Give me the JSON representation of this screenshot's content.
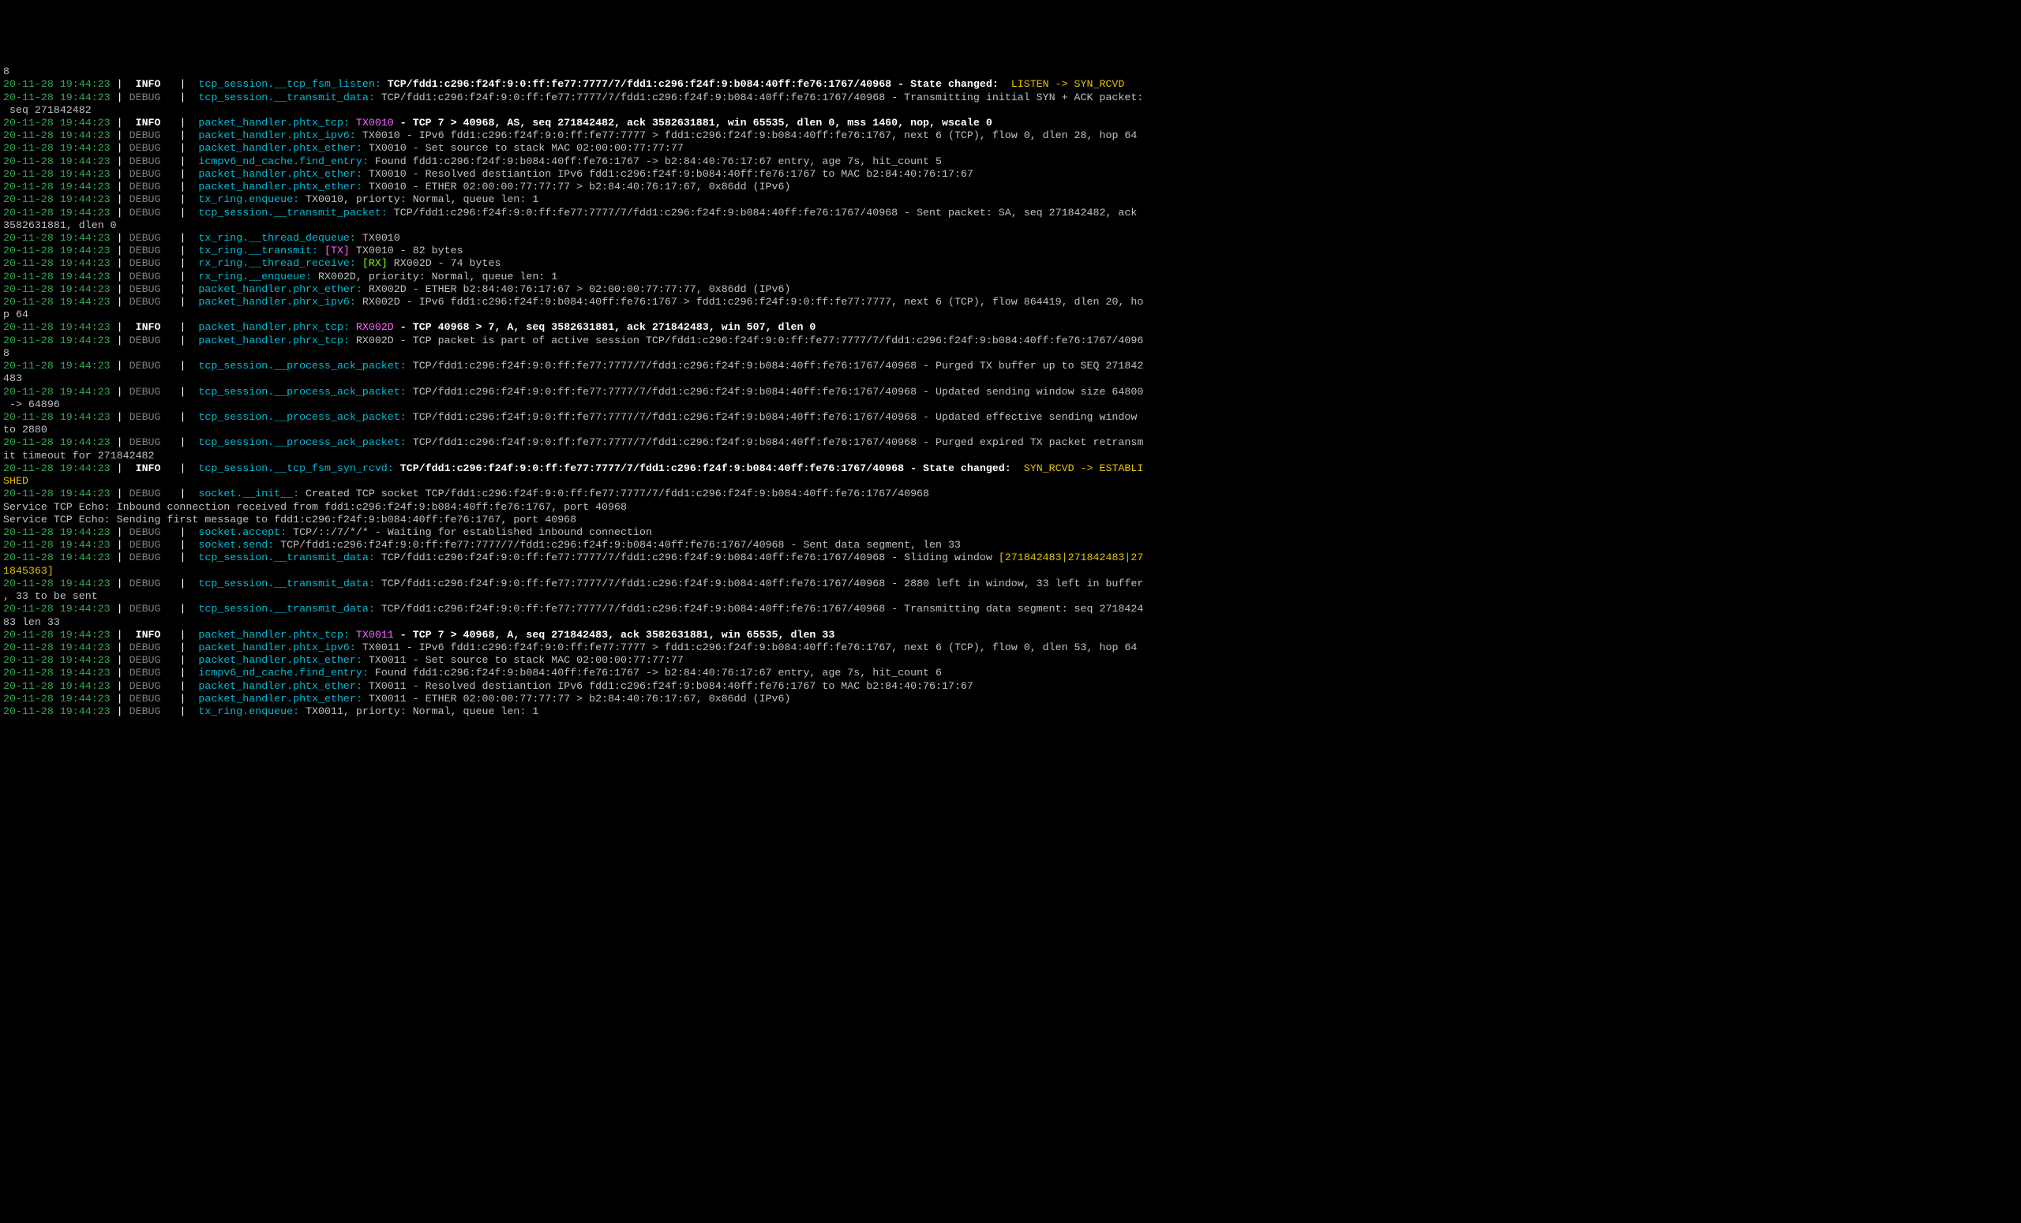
{
  "colors": {
    "timestamp": "#34a853",
    "info": "#ffffff",
    "debug": "#808080",
    "source": "#00bcd4",
    "yellow": "#e6c200",
    "magenta": "#ff66ff",
    "lime": "#7fff00"
  },
  "lines": [
    {
      "type": "wrap",
      "text": "8"
    },
    {
      "ts": "20-11-28 19:44:23",
      "level": "INFO",
      "src": "tcp_session.__tcp_fsm_listen:",
      "segs": [
        {
          "cls": "white",
          "text": " TCP/fdd1:c296:f24f:9:0:ff:fe77:7777/7/fdd1:c296:f24f:9:b084:40ff:fe76:1767/40968 - State changed: "
        },
        {
          "cls": "yellow",
          "text": " LISTEN -> SYN_RCVD"
        }
      ]
    },
    {
      "ts": "20-11-28 19:44:23",
      "level": "DEBUG",
      "src": "tcp_session.__transmit_data:",
      "segs": [
        {
          "cls": "msg",
          "text": " TCP/fdd1:c296:f24f:9:0:ff:fe77:7777/7/fdd1:c296:f24f:9:b084:40ff:fe76:1767/40968 - Transmitting initial SYN + ACK packet:"
        }
      ]
    },
    {
      "type": "wrap",
      "text": " seq 271842482"
    },
    {
      "ts": "20-11-28 19:44:23",
      "level": "INFO",
      "src": "packet_handler.phtx_tcp:",
      "segs": [
        {
          "cls": "magenta",
          "text": " TX0010"
        },
        {
          "cls": "white",
          "text": " - TCP 7 > 40968, AS, seq 271842482, ack 3582631881, win 65535, dlen 0, mss 1460, nop, wscale 0"
        }
      ]
    },
    {
      "ts": "20-11-28 19:44:23",
      "level": "DEBUG",
      "src": "packet_handler.phtx_ipv6:",
      "segs": [
        {
          "cls": "msg",
          "text": " TX0010 - IPv6 fdd1:c296:f24f:9:0:ff:fe77:7777 > fdd1:c296:f24f:9:b084:40ff:fe76:1767, next 6 (TCP), flow 0, dlen 28, hop 64"
        }
      ]
    },
    {
      "ts": "20-11-28 19:44:23",
      "level": "DEBUG",
      "src": "packet_handler.phtx_ether:",
      "segs": [
        {
          "cls": "msg",
          "text": " TX0010 - Set source to stack MAC 02:00:00:77:77:77"
        }
      ]
    },
    {
      "ts": "20-11-28 19:44:23",
      "level": "DEBUG",
      "src": "icmpv6_nd_cache.find_entry:",
      "segs": [
        {
          "cls": "msg",
          "text": " Found fdd1:c296:f24f:9:b084:40ff:fe76:1767 -> b2:84:40:76:17:67 entry, age 7s, hit_count 5"
        }
      ]
    },
    {
      "ts": "20-11-28 19:44:23",
      "level": "DEBUG",
      "src": "packet_handler.phtx_ether:",
      "segs": [
        {
          "cls": "msg",
          "text": " TX0010 - Resolved destiantion IPv6 fdd1:c296:f24f:9:b084:40ff:fe76:1767 to MAC b2:84:40:76:17:67"
        }
      ]
    },
    {
      "ts": "20-11-28 19:44:23",
      "level": "DEBUG",
      "src": "packet_handler.phtx_ether:",
      "segs": [
        {
          "cls": "msg",
          "text": " TX0010 - ETHER 02:00:00:77:77:77 > b2:84:40:76:17:67, 0x86dd (IPv6)"
        }
      ]
    },
    {
      "ts": "20-11-28 19:44:23",
      "level": "DEBUG",
      "src": "tx_ring.enqueue:",
      "segs": [
        {
          "cls": "msg",
          "text": " TX0010, priorty: Normal, queue len: 1"
        }
      ]
    },
    {
      "ts": "20-11-28 19:44:23",
      "level": "DEBUG",
      "src": "tcp_session.__transmit_packet:",
      "segs": [
        {
          "cls": "msg",
          "text": " TCP/fdd1:c296:f24f:9:0:ff:fe77:7777/7/fdd1:c296:f24f:9:b084:40ff:fe76:1767/40968 - Sent packet: SA, seq 271842482, ack "
        }
      ]
    },
    {
      "type": "wrap",
      "text": "3582631881, dlen 0"
    },
    {
      "ts": "20-11-28 19:44:23",
      "level": "DEBUG",
      "src": "tx_ring.__thread_dequeue:",
      "segs": [
        {
          "cls": "msg",
          "text": " TX0010"
        }
      ]
    },
    {
      "ts": "20-11-28 19:44:23",
      "level": "DEBUG",
      "src": "tx_ring.__transmit:",
      "segs": [
        {
          "cls": "magenta",
          "text": " [TX]"
        },
        {
          "cls": "msg",
          "text": " TX0010 - 82 bytes"
        }
      ]
    },
    {
      "ts": "20-11-28 19:44:23",
      "level": "DEBUG",
      "src": "rx_ring.__thread_receive:",
      "segs": [
        {
          "cls": "lime",
          "text": " [RX]"
        },
        {
          "cls": "msg",
          "text": " RX002D - 74 bytes"
        }
      ]
    },
    {
      "ts": "20-11-28 19:44:23",
      "level": "DEBUG",
      "src": "rx_ring.__enqueue:",
      "segs": [
        {
          "cls": "msg",
          "text": " RX002D, priority: Normal, queue len: 1"
        }
      ]
    },
    {
      "ts": "20-11-28 19:44:23",
      "level": "DEBUG",
      "src": "packet_handler.phrx_ether:",
      "segs": [
        {
          "cls": "msg",
          "text": " RX002D - ETHER b2:84:40:76:17:67 > 02:00:00:77:77:77, 0x86dd (IPv6)"
        }
      ]
    },
    {
      "ts": "20-11-28 19:44:23",
      "level": "DEBUG",
      "src": "packet_handler.phrx_ipv6:",
      "segs": [
        {
          "cls": "msg",
          "text": " RX002D - IPv6 fdd1:c296:f24f:9:b084:40ff:fe76:1767 > fdd1:c296:f24f:9:0:ff:fe77:7777, next 6 (TCP), flow 864419, dlen 20, ho"
        }
      ]
    },
    {
      "type": "wrap",
      "text": "p 64"
    },
    {
      "ts": "20-11-28 19:44:23",
      "level": "INFO",
      "src": "packet_handler.phrx_tcp:",
      "segs": [
        {
          "cls": "magenta",
          "text": " RX002D"
        },
        {
          "cls": "white",
          "text": " - TCP 40968 > 7, A, seq 3582631881, ack 271842483, win 507, dlen 0"
        }
      ]
    },
    {
      "ts": "20-11-28 19:44:23",
      "level": "DEBUG",
      "src": "packet_handler.phrx_tcp:",
      "segs": [
        {
          "cls": "msg",
          "text": " RX002D - TCP packet is part of active session TCP/fdd1:c296:f24f:9:0:ff:fe77:7777/7/fdd1:c296:f24f:9:b084:40ff:fe76:1767/4096"
        }
      ]
    },
    {
      "type": "wrap",
      "text": "8"
    },
    {
      "ts": "20-11-28 19:44:23",
      "level": "DEBUG",
      "src": "tcp_session.__process_ack_packet:",
      "segs": [
        {
          "cls": "msg",
          "text": " TCP/fdd1:c296:f24f:9:0:ff:fe77:7777/7/fdd1:c296:f24f:9:b084:40ff:fe76:1767/40968 - Purged TX buffer up to SEQ 271842"
        }
      ]
    },
    {
      "type": "wrap",
      "text": "483"
    },
    {
      "ts": "20-11-28 19:44:23",
      "level": "DEBUG",
      "src": "tcp_session.__process_ack_packet:",
      "segs": [
        {
          "cls": "msg",
          "text": " TCP/fdd1:c296:f24f:9:0:ff:fe77:7777/7/fdd1:c296:f24f:9:b084:40ff:fe76:1767/40968 - Updated sending window size 64800"
        }
      ]
    },
    {
      "type": "wrap",
      "text": " -> 64896"
    },
    {
      "ts": "20-11-28 19:44:23",
      "level": "DEBUG",
      "src": "tcp_session.__process_ack_packet:",
      "segs": [
        {
          "cls": "msg",
          "text": " TCP/fdd1:c296:f24f:9:0:ff:fe77:7777/7/fdd1:c296:f24f:9:b084:40ff:fe76:1767/40968 - Updated effective sending window "
        }
      ]
    },
    {
      "type": "wrap",
      "text": "to 2880"
    },
    {
      "ts": "20-11-28 19:44:23",
      "level": "DEBUG",
      "src": "tcp_session.__process_ack_packet:",
      "segs": [
        {
          "cls": "msg",
          "text": " TCP/fdd1:c296:f24f:9:0:ff:fe77:7777/7/fdd1:c296:f24f:9:b084:40ff:fe76:1767/40968 - Purged expired TX packet retransm"
        }
      ]
    },
    {
      "type": "wrap",
      "text": "it timeout for 271842482"
    },
    {
      "ts": "20-11-28 19:44:23",
      "level": "INFO",
      "src": "tcp_session.__tcp_fsm_syn_rcvd:",
      "segs": [
        {
          "cls": "white",
          "text": " TCP/fdd1:c296:f24f:9:0:ff:fe77:7777/7/fdd1:c296:f24f:9:b084:40ff:fe76:1767/40968 - State changed: "
        },
        {
          "cls": "yellow",
          "text": " SYN_RCVD -> ESTABLI"
        }
      ]
    },
    {
      "type": "wrap",
      "cls": "yellow",
      "text": "SHED"
    },
    {
      "ts": "20-11-28 19:44:23",
      "level": "DEBUG",
      "src": "socket.__init__:",
      "segs": [
        {
          "cls": "msg",
          "text": " Created TCP socket TCP/fdd1:c296:f24f:9:0:ff:fe77:7777/7/fdd1:c296:f24f:9:b084:40ff:fe76:1767/40968"
        }
      ]
    },
    {
      "type": "raw",
      "text": "Service TCP Echo: Inbound connection received from fdd1:c296:f24f:9:b084:40ff:fe76:1767, port 40968"
    },
    {
      "type": "raw",
      "text": "Service TCP Echo: Sending first message to fdd1:c296:f24f:9:b084:40ff:fe76:1767, port 40968"
    },
    {
      "ts": "20-11-28 19:44:23",
      "level": "DEBUG",
      "src": "socket.accept:",
      "segs": [
        {
          "cls": "msg",
          "text": " TCP/::/7/*/* - Waiting for established inbound connection"
        }
      ]
    },
    {
      "ts": "20-11-28 19:44:23",
      "level": "DEBUG",
      "src": "socket.send:",
      "segs": [
        {
          "cls": "msg",
          "text": " TCP/fdd1:c296:f24f:9:0:ff:fe77:7777/7/fdd1:c296:f24f:9:b084:40ff:fe76:1767/40968 - Sent data segment, len 33"
        }
      ]
    },
    {
      "ts": "20-11-28 19:44:23",
      "level": "DEBUG",
      "src": "tcp_session.__transmit_data:",
      "segs": [
        {
          "cls": "msg",
          "text": " TCP/fdd1:c296:f24f:9:0:ff:fe77:7777/7/fdd1:c296:f24f:9:b084:40ff:fe76:1767/40968 - Sliding window "
        },
        {
          "cls": "yellow",
          "text": "[271842483|271842483|27"
        }
      ]
    },
    {
      "type": "wrap",
      "cls": "yellow",
      "text": "1845363]"
    },
    {
      "ts": "20-11-28 19:44:23",
      "level": "DEBUG",
      "src": "tcp_session.__transmit_data:",
      "segs": [
        {
          "cls": "msg",
          "text": " TCP/fdd1:c296:f24f:9:0:ff:fe77:7777/7/fdd1:c296:f24f:9:b084:40ff:fe76:1767/40968 - 2880 left in window, 33 left in buffer"
        }
      ]
    },
    {
      "type": "wrap",
      "text": ", 33 to be sent"
    },
    {
      "ts": "20-11-28 19:44:23",
      "level": "DEBUG",
      "src": "tcp_session.__transmit_data:",
      "segs": [
        {
          "cls": "msg",
          "text": " TCP/fdd1:c296:f24f:9:0:ff:fe77:7777/7/fdd1:c296:f24f:9:b084:40ff:fe76:1767/40968 - Transmitting data segment: seq 2718424"
        }
      ]
    },
    {
      "type": "wrap",
      "text": "83 len 33"
    },
    {
      "ts": "20-11-28 19:44:23",
      "level": "INFO",
      "src": "packet_handler.phtx_tcp:",
      "segs": [
        {
          "cls": "magenta",
          "text": " TX0011"
        },
        {
          "cls": "white",
          "text": " - TCP 7 > 40968, A, seq 271842483, ack 3582631881, win 65535, dlen 33"
        }
      ]
    },
    {
      "ts": "20-11-28 19:44:23",
      "level": "DEBUG",
      "src": "packet_handler.phtx_ipv6:",
      "segs": [
        {
          "cls": "msg",
          "text": " TX0011 - IPv6 fdd1:c296:f24f:9:0:ff:fe77:7777 > fdd1:c296:f24f:9:b084:40ff:fe76:1767, next 6 (TCP), flow 0, dlen 53, hop 64"
        }
      ]
    },
    {
      "ts": "20-11-28 19:44:23",
      "level": "DEBUG",
      "src": "packet_handler.phtx_ether:",
      "segs": [
        {
          "cls": "msg",
          "text": " TX0011 - Set source to stack MAC 02:00:00:77:77:77"
        }
      ]
    },
    {
      "ts": "20-11-28 19:44:23",
      "level": "DEBUG",
      "src": "icmpv6_nd_cache.find_entry:",
      "segs": [
        {
          "cls": "msg",
          "text": " Found fdd1:c296:f24f:9:b084:40ff:fe76:1767 -> b2:84:40:76:17:67 entry, age 7s, hit_count 6"
        }
      ]
    },
    {
      "ts": "20-11-28 19:44:23",
      "level": "DEBUG",
      "src": "packet_handler.phtx_ether:",
      "segs": [
        {
          "cls": "msg",
          "text": " TX0011 - Resolved destiantion IPv6 fdd1:c296:f24f:9:b084:40ff:fe76:1767 to MAC b2:84:40:76:17:67"
        }
      ]
    },
    {
      "ts": "20-11-28 19:44:23",
      "level": "DEBUG",
      "src": "packet_handler.phtx_ether:",
      "segs": [
        {
          "cls": "msg",
          "text": " TX0011 - ETHER 02:00:00:77:77:77 > b2:84:40:76:17:67, 0x86dd (IPv6)"
        }
      ]
    },
    {
      "ts": "20-11-28 19:44:23",
      "level": "DEBUG",
      "src": "tx_ring.enqueue:",
      "segs": [
        {
          "cls": "msg",
          "text": " TX0011, priorty: Normal, queue len: 1"
        }
      ]
    }
  ]
}
